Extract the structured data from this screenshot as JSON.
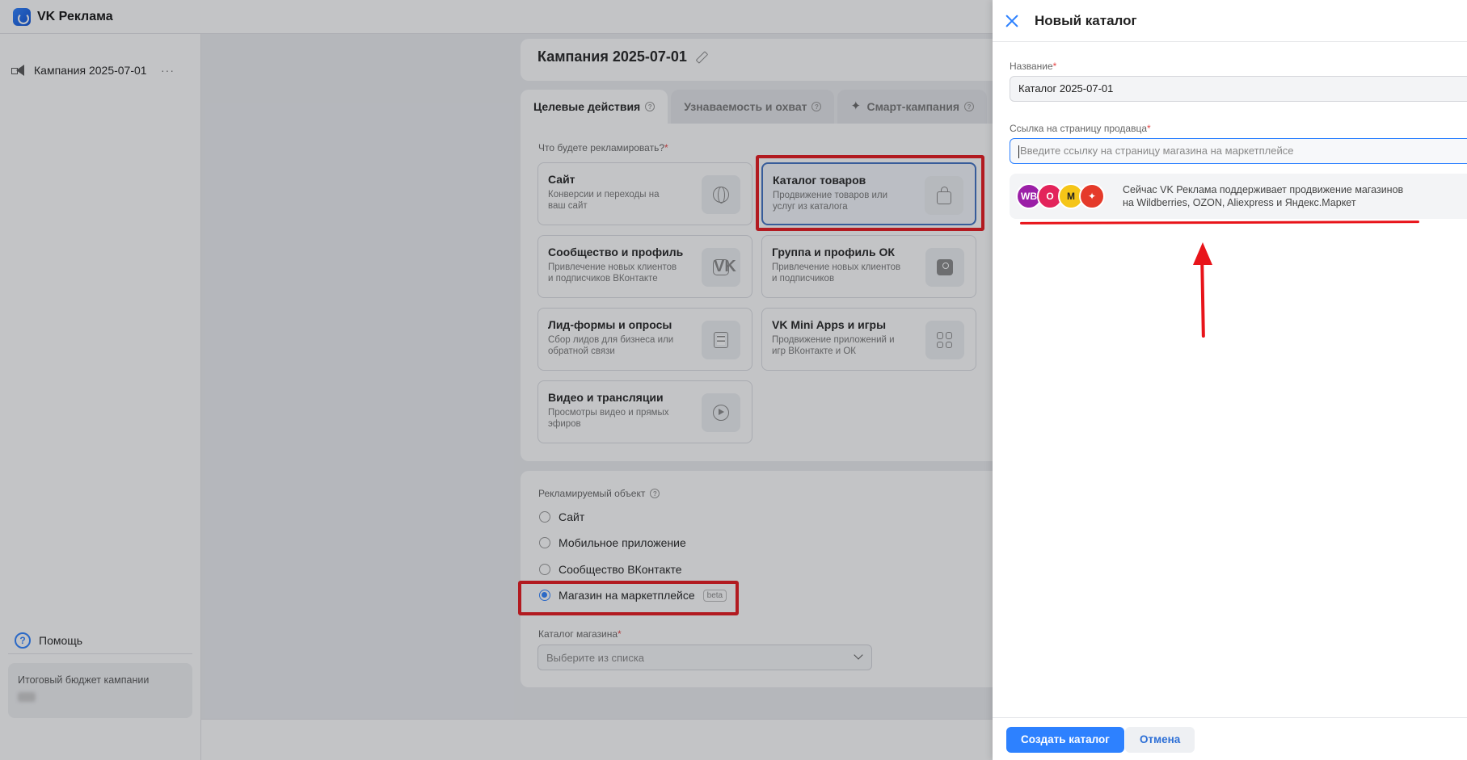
{
  "app": {
    "title": "VK Реклама"
  },
  "sidebar": {
    "campaign_label": "Кампания 2025-07-01",
    "more": "···",
    "help_label": "Помощь",
    "budget_label": "Итоговый бюджет кампании"
  },
  "campaign": {
    "title": "Кампания 2025-07-01",
    "tabs": [
      {
        "label": "Целевые действия",
        "active": true
      },
      {
        "label": "Узнаваемость и охват",
        "active": false
      },
      {
        "label": "Смарт-кампания",
        "active": false
      }
    ],
    "question": "Что будете рекламировать?",
    "options": [
      {
        "title": "Сайт",
        "desc": "Конверсии и переходы на ваш сайт",
        "icon": "globe-icon",
        "selected": false
      },
      {
        "title": "Каталог товаров",
        "desc": "Продвижение товаров или услуг из каталога",
        "icon": "bag-icon",
        "selected": true
      },
      {
        "title": "Сообщество и профиль",
        "desc": "Привлечение новых клиентов и подписчиков ВКонтакте",
        "icon": "vk-icon",
        "selected": false
      },
      {
        "title": "Группа и профиль ОК",
        "desc": "Привлечение новых клиентов и подписчиков",
        "icon": "ok-icon",
        "selected": false
      },
      {
        "title": "Лид-формы и опросы",
        "desc": "Сбор лидов для бизнеса или обратной связи",
        "icon": "list-icon",
        "selected": false
      },
      {
        "title": "VK Mini Apps и игры",
        "desc": "Продвижение приложений и игр ВКонтакте и ОК",
        "icon": "apps-icon",
        "selected": false
      },
      {
        "title": "Видео и трансляции",
        "desc": "Просмотры видео и прямых эфиров",
        "icon": "play-icon",
        "selected": false
      }
    ],
    "object_label": "Рекламируемый объект",
    "objects": [
      {
        "label": "Сайт",
        "checked": false
      },
      {
        "label": "Мобильное приложение",
        "checked": false
      },
      {
        "label": "Сообщество ВКонтакте",
        "checked": false
      },
      {
        "label": "Магазин на маркетплейсе",
        "checked": true,
        "badge": "beta"
      }
    ],
    "catalog_label": "Каталог магазина",
    "catalog_placeholder": "Выберите из списка"
  },
  "panel": {
    "title": "Новый каталог",
    "name_label": "Название",
    "name_value": "Каталог 2025-07-01",
    "link_label": "Ссылка на страницу продавца",
    "link_placeholder": "Введите ссылку на страницу магазина на маркетплейсе",
    "info_line1": "Сейчас VK Реклама поддерживает продвижение магазинов",
    "info_line2": "на Wildberries, OZON, Aliexpress и Яндекс.Маркет",
    "logos": [
      {
        "text": "WB",
        "color": "#9b1fa7"
      },
      {
        "text": "O",
        "color": "#e3245b"
      },
      {
        "text": "M",
        "color": "#f5c518"
      },
      {
        "text": "✦",
        "color": "#e53a2a"
      }
    ],
    "create_button": "Создать каталог",
    "cancel_button": "Отмена"
  },
  "colors": {
    "accent": "#2d81ff",
    "highlight": "#e8141a"
  }
}
